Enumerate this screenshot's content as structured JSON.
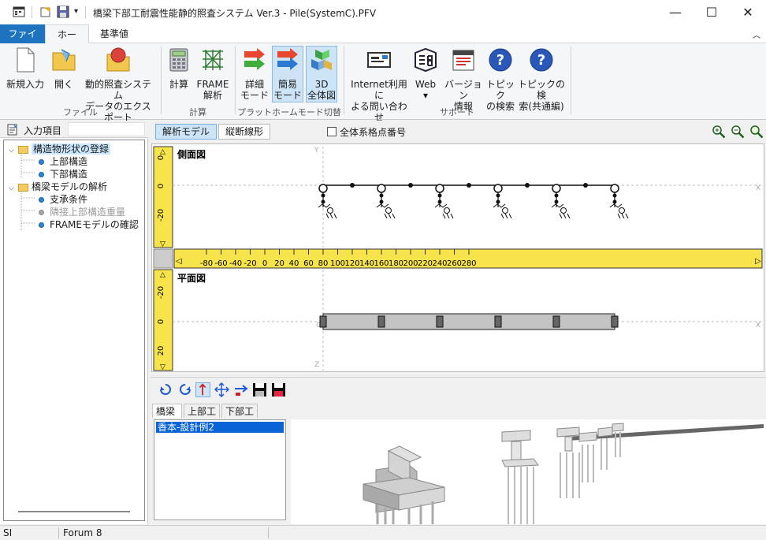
{
  "window": {
    "title": "橋梁下部工耐震性能静的照査システム Ver.3 - Pile(SystemC).PFV",
    "minimize": "—",
    "maximize": "☐",
    "close": "✕"
  },
  "tabs": [
    {
      "label": "ファイル"
    },
    {
      "label": "ホーム"
    },
    {
      "label": "基準値"
    }
  ],
  "ribbon": {
    "buttons": [
      {
        "line1": "新規入力",
        "line2": "",
        "icon": "new-file-icon"
      },
      {
        "line1": "開く",
        "line2": "",
        "icon": "open-folder-icon"
      },
      {
        "line1": "動的照査システム",
        "line2": "データのエクスポート",
        "icon": "export-icon"
      },
      {
        "line1": "計算",
        "line2": "",
        "icon": "calculator-icon"
      },
      {
        "line1": "FRAME",
        "line2": "解析",
        "icon": "frame-icon"
      },
      {
        "line1": "詳細",
        "line2": "モード",
        "icon": "detail-mode-icon"
      },
      {
        "line1": "簡易",
        "line2": "モード",
        "icon": "simple-mode-icon"
      },
      {
        "line1": "3D",
        "line2": "全体図",
        "icon": "3d-icon"
      },
      {
        "line1": "Internet利用に",
        "line2": "よる問い合わせ",
        "icon": "internet-icon"
      },
      {
        "line1": "Web",
        "line2": "▾",
        "icon": "web-icon"
      },
      {
        "line1": "バージョン",
        "line2": "情報",
        "icon": "version-icon"
      },
      {
        "line1": "トピック",
        "line2": "の検索",
        "icon": "help-icon"
      },
      {
        "line1": "トピックの検",
        "line2": "索(共通編)",
        "icon": "help-icon"
      }
    ],
    "groups": [
      "ファイル",
      "計算",
      "プラットホームモード切替",
      "サポート"
    ]
  },
  "left_panel": {
    "header": "入力項目",
    "tree": [
      {
        "label": "構造物形状の登録",
        "level": 0,
        "type": "folder",
        "selected": true
      },
      {
        "label": "上部構造",
        "level": 1,
        "type": "item"
      },
      {
        "label": "下部構造",
        "level": 1,
        "type": "item"
      },
      {
        "label": "橋梁モデルの解析",
        "level": 0,
        "type": "folder"
      },
      {
        "label": "支承条件",
        "level": 1,
        "type": "item"
      },
      {
        "label": "隣接上部構造重量",
        "level": 1,
        "type": "item",
        "disabled": true
      },
      {
        "label": "FRAMEモデルの確認",
        "level": 1,
        "type": "item"
      }
    ]
  },
  "view_toolbar": {
    "tab1": "解析モデル",
    "tab2": "縦断線形",
    "checkbox_label": "全体系格点番号",
    "checkbox_checked": false
  },
  "canvas": {
    "side_view_label": "側面図",
    "plan_view_label": "平面図",
    "axis_y": "Y",
    "axis_x": "X",
    "axis_z": "Z",
    "origin": "0",
    "ruler_ticks": [
      "-80",
      "-60",
      "-40",
      "-20",
      "0",
      "20",
      "40",
      "60",
      "80",
      "100",
      "120",
      "140",
      "160",
      "180",
      "200",
      "220",
      "240",
      "260",
      "280"
    ],
    "v_ruler_top": [
      "0",
      "0",
      "-20"
    ],
    "v_ruler_bottom": [
      "-20",
      "0",
      "20"
    ]
  },
  "bottom": {
    "tabs": [
      "橋梁",
      "上部工",
      "下部工"
    ],
    "list_items": [
      "香本-設計例2"
    ]
  },
  "status": {
    "unit": "SI",
    "vendor": "Forum 8"
  }
}
